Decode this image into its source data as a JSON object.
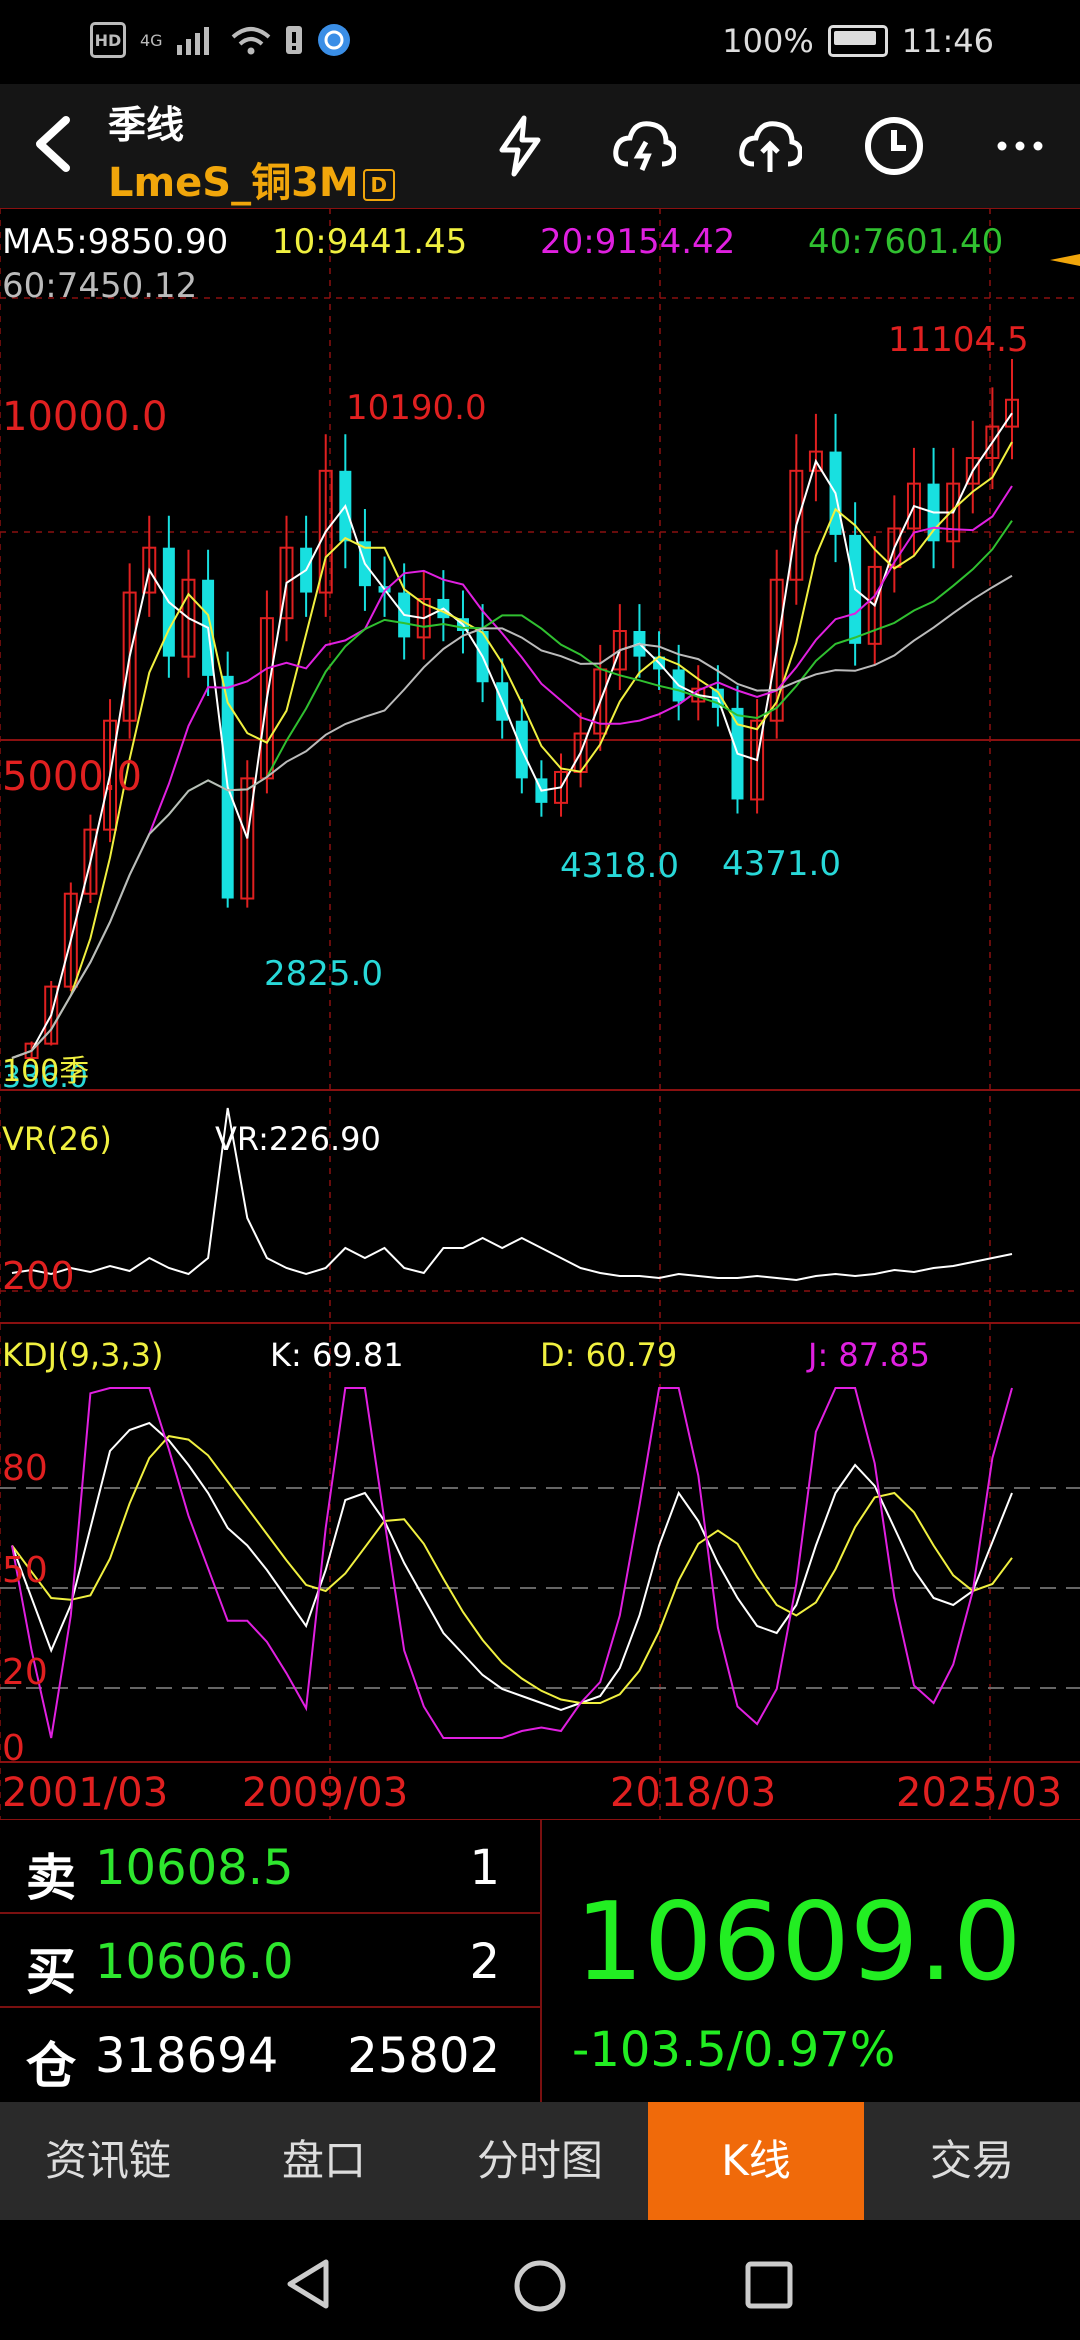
{
  "status_bar": {
    "badges": [
      "HD",
      "4G"
    ],
    "battery": "100%",
    "time": "11:46"
  },
  "header": {
    "title": "季线",
    "symbol": "LmeS_铜3M",
    "symbol_badge": "D"
  },
  "ma_line": {
    "ma5": "MA5:9850.90",
    "ma10": "10:9441.45",
    "ma20": "20:9154.42",
    "ma40": "40:7601.40",
    "ma60": "60:7450.12"
  },
  "price_axis": {
    "level_high": "10000.0",
    "level_mid": "5000.0"
  },
  "annotations": {
    "max": "11104.5",
    "peak1": "10190.0",
    "low1": "2825.0",
    "low2": "4318.0",
    "low3": "4371.0",
    "start": "100季",
    "start_price": "336.0"
  },
  "vr": {
    "name": "VR(26)",
    "value": "VR:226.90",
    "level": "200"
  },
  "kdj": {
    "name": "KDJ(9,3,3)",
    "k": "K: 69.81",
    "d": "D: 60.79",
    "j": "J: 87.85",
    "levels": [
      "80",
      "50",
      "20",
      "0"
    ]
  },
  "dates": [
    "2001/03",
    "2009/03",
    "2018/03",
    "2025/03"
  ],
  "book": {
    "sell_label": "卖",
    "sell_price": "10608.5",
    "sell_qty": "1",
    "buy_label": "买",
    "buy_price": "10606.0",
    "buy_qty": "2",
    "pos_label": "仓",
    "pos_value": "318694",
    "pos_value2": "25802"
  },
  "last_price": "10609.0",
  "change": "-103.5/0.97%",
  "tabs": [
    "资讯链",
    "盘口",
    "分时图",
    "K线",
    "交易"
  ],
  "active_tab": "K线",
  "colors": {
    "accent": "#f06a0a",
    "up": "#e02020",
    "down": "#18e0e0",
    "ma5": "#ffffff",
    "ma10": "#f0f040",
    "ma20": "#e020e0",
    "ma40": "#30c030",
    "ma60": "#bbbbbb"
  },
  "chart_data": {
    "type": "candlestick",
    "period": "quarterly",
    "x_ticks": [
      "2001/03",
      "2009/03",
      "2018/03",
      "2025/03"
    ],
    "ma": {
      "MA5": 9850.9,
      "MA10": 9441.45,
      "MA20": 9154.42,
      "MA40": 7601.4,
      "MA60": 7450.12
    },
    "labeled_points": [
      {
        "label": "336.0",
        "value": 336.0
      },
      {
        "label": "2825.0",
        "value": 2825.0
      },
      {
        "label": "10190.0",
        "value": 10190.0
      },
      {
        "label": "4318.0",
        "value": 4318.0
      },
      {
        "label": "4371.0",
        "value": 4371.0
      },
      {
        "label": "11104.5",
        "value": 11104.5
      }
    ],
    "close_series": [
      336,
      560,
      1450,
      2900,
      3900,
      5600,
      7600,
      8300,
      6600,
      7800,
      6300,
      2825,
      4700,
      7200,
      8300,
      7600,
      9500,
      8400,
      7700,
      7600,
      6900,
      7500,
      7200,
      7000,
      6200,
      5600,
      4700,
      4318,
      4800,
      5400,
      6400,
      7000,
      6600,
      6400,
      5900,
      6100,
      5800,
      4371,
      5600,
      7800,
      9500,
      9800,
      8500,
      6800,
      8000,
      8600,
      9300,
      8400,
      9300,
      9700,
      10190,
      10609
    ],
    "indicators": {
      "VR": {
        "value": 226.9,
        "level": 200
      },
      "KDJ": {
        "K": 69.81,
        "D": 60.79,
        "J": 87.85,
        "levels": [
          80,
          50,
          20,
          0
        ]
      }
    }
  }
}
